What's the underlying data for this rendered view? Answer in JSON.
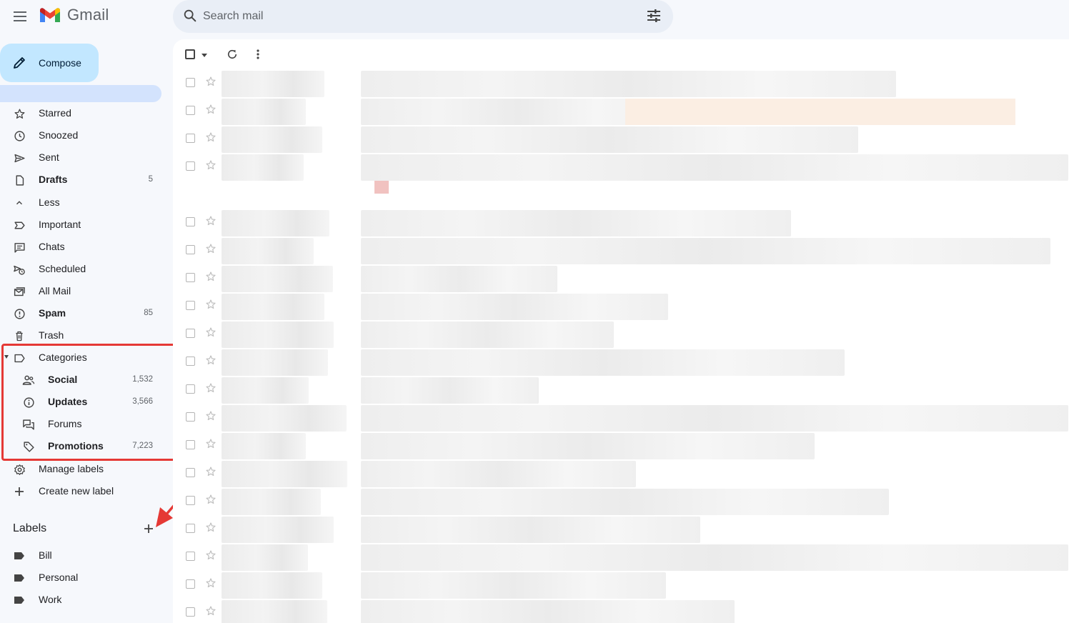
{
  "header": {
    "app_name": "Gmail",
    "search_placeholder": "Search mail"
  },
  "compose": {
    "label": "Compose"
  },
  "nav": [
    {
      "name": "starred",
      "label": "Starred",
      "count": "",
      "bold": false
    },
    {
      "name": "snoozed",
      "label": "Snoozed",
      "count": "",
      "bold": false
    },
    {
      "name": "sent",
      "label": "Sent",
      "count": "",
      "bold": false
    },
    {
      "name": "drafts",
      "label": "Drafts",
      "count": "5",
      "bold": true
    },
    {
      "name": "less",
      "label": "Less",
      "count": "",
      "bold": false
    },
    {
      "name": "important",
      "label": "Important",
      "count": "",
      "bold": false
    },
    {
      "name": "chats",
      "label": "Chats",
      "count": "",
      "bold": false
    },
    {
      "name": "scheduled",
      "label": "Scheduled",
      "count": "",
      "bold": false
    },
    {
      "name": "all-mail",
      "label": "All Mail",
      "count": "",
      "bold": false
    },
    {
      "name": "spam",
      "label": "Spam",
      "count": "85",
      "bold": true
    },
    {
      "name": "trash",
      "label": "Trash",
      "count": "",
      "bold": false
    },
    {
      "name": "categories",
      "label": "Categories",
      "count": "",
      "bold": false
    },
    {
      "name": "social",
      "label": "Social",
      "count": "1,532",
      "bold": true
    },
    {
      "name": "updates",
      "label": "Updates",
      "count": "3,566",
      "bold": true
    },
    {
      "name": "forums",
      "label": "Forums",
      "count": "",
      "bold": false
    },
    {
      "name": "promotions",
      "label": "Promotions",
      "count": "7,223",
      "bold": true
    },
    {
      "name": "manage-labels",
      "label": "Manage labels",
      "count": "",
      "bold": false
    },
    {
      "name": "create-new-label",
      "label": "Create new label",
      "count": "",
      "bold": false
    }
  ],
  "labels_section": {
    "heading": "Labels",
    "items": [
      {
        "label": "Bill"
      },
      {
        "label": "Personal"
      },
      {
        "label": "Work"
      }
    ]
  },
  "colors": {
    "compose_bg": "#c2e7ff",
    "active_bg": "#d3e3fd",
    "highlight": "#e53935",
    "search_bg": "#e9eef6",
    "app_bg": "#f6f8fc"
  }
}
